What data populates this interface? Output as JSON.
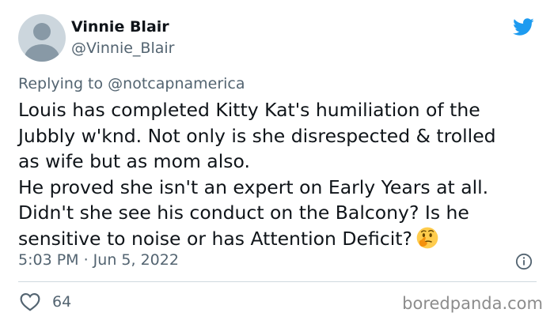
{
  "author": {
    "name": "Vinnie Blair",
    "handle": "@Vinnie_Blair"
  },
  "reply": {
    "prefix": "Replying to",
    "mention": "@notcapnamerica"
  },
  "tweet": {
    "lines": [
      "Louis has completed Kitty Kat's humiliation of the",
      "Jubbly w'knd. Not only is she disrespected & trolled",
      "as wife but as mom also.",
      "He proved she isn't an expert on Early Years at all.",
      "Didn't she see his conduct on the Balcony? Is he",
      "sensitive to noise or has Attention Deficit?"
    ],
    "emoji": "thinking-face"
  },
  "meta": {
    "timestamp": "5:03 PM · Jun 5, 2022"
  },
  "actions": {
    "like_count": "64"
  },
  "watermark": "boredpanda.com",
  "colors": {
    "twitter_blue": "#1d9bf0",
    "secondary_text": "#536471",
    "primary_text": "#0f1419"
  }
}
